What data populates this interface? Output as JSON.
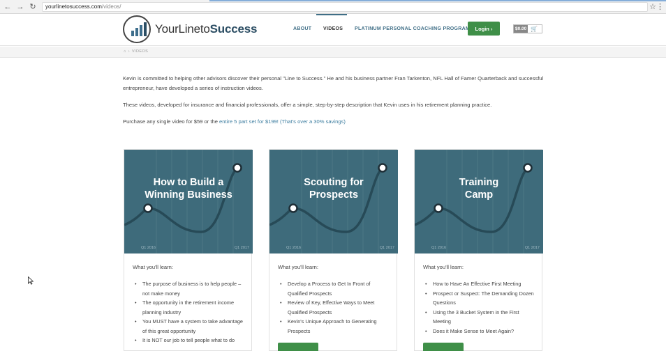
{
  "browser": {
    "url_host": "yourlinetosuccess.com",
    "url_path": "/videos/"
  },
  "header": {
    "logo_text_plain": "YourLineto",
    "logo_text_bold": "Success",
    "nav": [
      {
        "label": "ABOUT",
        "active": false
      },
      {
        "label": "VIDEOS",
        "active": true
      },
      {
        "label": "PLATINUM PERSONAL COACHING PROGRAM",
        "active": false
      }
    ],
    "login_label": "Login",
    "cart_amount": "$0.00"
  },
  "breadcrumb": {
    "current": "VIDEOS"
  },
  "intro": {
    "p1": "Kevin is committed to helping other advisors discover their personal \"Line to Success.\" He and his business partner Fran Tarkenton, NFL Hall of Famer Quarterback and successful entrepreneur, have developed a series of instruction videos.",
    "p2": "These videos, developed for insurance and financial professionals, offer a simple, step-by-step description that Kevin uses in his retirement planning practice.",
    "p3_text": "Purchase any single video for $59 or the ",
    "p3_link": "entire 5 part set for $199! (That's over a 30% savings)"
  },
  "cards": [
    {
      "title_line1": "How to Build a",
      "title_line2": "Winning Business",
      "q_start": "Q1 2016",
      "q_end": "Q1 2017",
      "learn_label": "What you'll learn:",
      "items": [
        "The purpose of business is to help people – not make money",
        "The opportunity in the retirement income planning industry",
        "You MUST have a system to take advantage of this great opportunity",
        "It is NOT our job to tell people what to do"
      ]
    },
    {
      "title_line1": "Scouting for",
      "title_line2": "Prospects",
      "q_start": "Q1 2016",
      "q_end": "Q1 2017",
      "learn_label": "What you'll learn:",
      "items": [
        "Develop a Process to Get In Front of Qualified Prospects",
        "Review of Key, Effective Ways to Meet Qualified Prospects",
        "Kevin's Unique Approach to Generating Prospects"
      ]
    },
    {
      "title_line1": "Training",
      "title_line2": "Camp",
      "q_start": "Q1 2016",
      "q_end": "Q1 2017",
      "learn_label": "What you'll learn:",
      "items": [
        "How to Have An Effective First Meeting",
        "Prospect or Suspect: The Demanding Dozen Questions",
        "Using the 3 Bucket System in the First Meeting",
        "Does it Make Sense to Meet Again?"
      ]
    }
  ]
}
